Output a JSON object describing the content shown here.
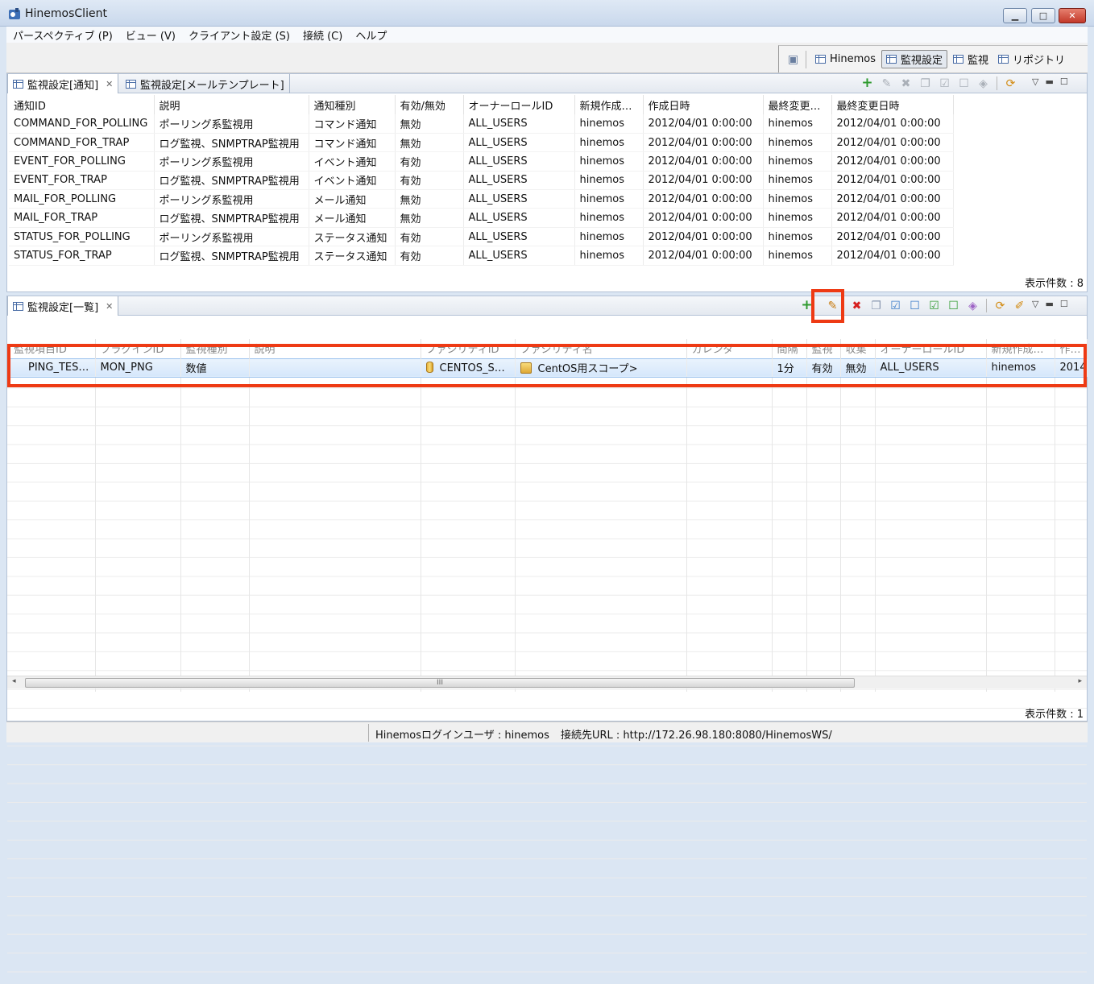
{
  "window": {
    "title": "HinemosClient",
    "minimize": "▁",
    "maximize": "□",
    "close": "✕"
  },
  "menu": [
    "パースペクティブ (P)",
    "ビュー (V)",
    "クライアント設定 (S)",
    "接続 (C)",
    "ヘルプ"
  ],
  "perspectives": {
    "items": [
      {
        "label": "Hinemos",
        "active": false
      },
      {
        "label": "監視設定",
        "active": true
      },
      {
        "label": "監視",
        "active": false
      },
      {
        "label": "リポジトリ",
        "active": false
      }
    ]
  },
  "notify_panel": {
    "tabs": [
      {
        "label": "監視設定[通知]",
        "active": true
      },
      {
        "label": "監視設定[メールテンプレート]",
        "active": false
      }
    ],
    "columns": [
      "通知ID",
      "説明",
      "通知種別",
      "有効/無効",
      "オーナーロールID",
      "新規作成…",
      "作成日時",
      "最終変更…",
      "最終変更日時"
    ],
    "rows": [
      [
        "COMMAND_FOR_POLLING",
        "ポーリング系監視用",
        "コマンド通知",
        "無効",
        "ALL_USERS",
        "hinemos",
        "2012/04/01 0:00:00",
        "hinemos",
        "2012/04/01 0:00:00"
      ],
      [
        "COMMAND_FOR_TRAP",
        "ログ監視、SNMPTRAP監視用",
        "コマンド通知",
        "無効",
        "ALL_USERS",
        "hinemos",
        "2012/04/01 0:00:00",
        "hinemos",
        "2012/04/01 0:00:00"
      ],
      [
        "EVENT_FOR_POLLING",
        "ポーリング系監視用",
        "イベント通知",
        "有効",
        "ALL_USERS",
        "hinemos",
        "2012/04/01 0:00:00",
        "hinemos",
        "2012/04/01 0:00:00"
      ],
      [
        "EVENT_FOR_TRAP",
        "ログ監視、SNMPTRAP監視用",
        "イベント通知",
        "有効",
        "ALL_USERS",
        "hinemos",
        "2012/04/01 0:00:00",
        "hinemos",
        "2012/04/01 0:00:00"
      ],
      [
        "MAIL_FOR_POLLING",
        "ポーリング系監視用",
        "メール通知",
        "無効",
        "ALL_USERS",
        "hinemos",
        "2012/04/01 0:00:00",
        "hinemos",
        "2012/04/01 0:00:00"
      ],
      [
        "MAIL_FOR_TRAP",
        "ログ監視、SNMPTRAP監視用",
        "メール通知",
        "無効",
        "ALL_USERS",
        "hinemos",
        "2012/04/01 0:00:00",
        "hinemos",
        "2012/04/01 0:00:00"
      ],
      [
        "STATUS_FOR_POLLING",
        "ポーリング系監視用",
        "ステータス通知",
        "有効",
        "ALL_USERS",
        "hinemos",
        "2012/04/01 0:00:00",
        "hinemos",
        "2012/04/01 0:00:00"
      ],
      [
        "STATUS_FOR_TRAP",
        "ログ監視、SNMPTRAP監視用",
        "ステータス通知",
        "有効",
        "ALL_USERS",
        "hinemos",
        "2012/04/01 0:00:00",
        "hinemos",
        "2012/04/01 0:00:00"
      ]
    ],
    "count_label": "表示件数 : 8"
  },
  "monitor_panel": {
    "tab": "監視設定[一覧]",
    "columns": [
      "監視項目ID",
      "プラグインID",
      "監視種別",
      "説明",
      "ファシリティID",
      "ファシリティ名",
      "カレンダ",
      "間隔",
      "監視",
      "収集",
      "オーナーロールID",
      "新規作成…",
      "作成…"
    ],
    "row": {
      "monitor_id": "PING_TES…",
      "plugin_id": "MON_PNG",
      "type": "数値",
      "description": "",
      "facility_id": "CENTOS_S…",
      "facility_name": "CentOS用スコープ>",
      "calendar": "",
      "interval": "1分",
      "monitor": "有効",
      "collect": "無効",
      "owner": "ALL_USERS",
      "creator": "hinemos",
      "created": "2014"
    },
    "count_label": "表示件数 : 1",
    "scroll_grip": "III"
  },
  "status": {
    "login_user": "Hinemosログインユーザ : hinemos",
    "url": "接続先URL : http://172.26.98.180:8080/HinemosWS/"
  },
  "icons": {
    "add": "plus-icon",
    "edit": "pencil-icon",
    "delete": "delete-icon",
    "copy": "copy-icon",
    "enable": "check-icon",
    "disable": "uncheck-icon",
    "refresh": "refresh-icon"
  },
  "colors": {
    "highlight": "#ee3a14",
    "selection": "#d5e7fb"
  }
}
